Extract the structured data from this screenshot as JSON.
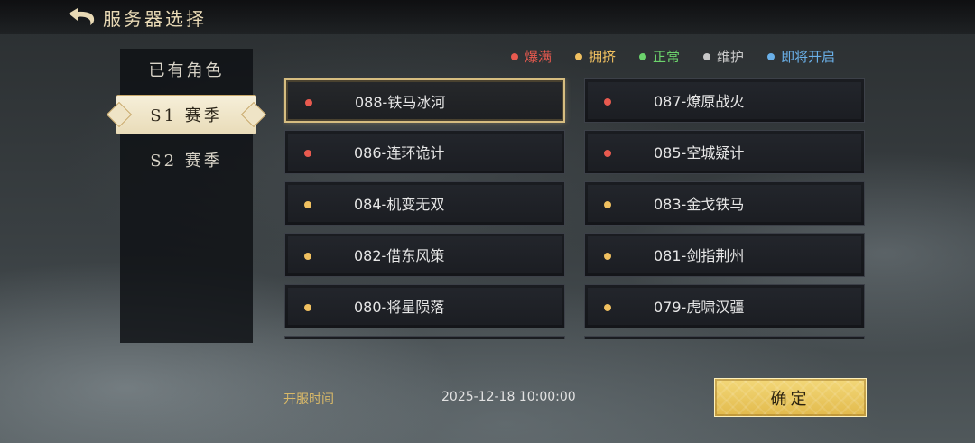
{
  "header": {
    "title": "服务器选择",
    "back_icon": "back-arrow-icon"
  },
  "sidebar": {
    "items": [
      {
        "label": "已有角色",
        "active": false
      },
      {
        "label": "S1 赛季",
        "active": true
      },
      {
        "label": "S2 赛季",
        "active": false
      }
    ]
  },
  "legend": [
    {
      "label": "爆满",
      "color": "#e85a4f"
    },
    {
      "label": "拥挤",
      "color": "#f0c060"
    },
    {
      "label": "正常",
      "color": "#6cd36c"
    },
    {
      "label": "维护",
      "color": "#c8c8c8"
    },
    {
      "label": "即将开启",
      "color": "#6ab0e8"
    }
  ],
  "servers": [
    {
      "name": "088-铁马冰河",
      "status": "爆满",
      "color": "#e85a4f",
      "selected": true
    },
    {
      "name": "087-燎原战火",
      "status": "爆满",
      "color": "#e85a4f",
      "selected": false
    },
    {
      "name": "086-连环诡计",
      "status": "爆满",
      "color": "#e85a4f",
      "selected": false
    },
    {
      "name": "085-空城疑计",
      "status": "爆满",
      "color": "#e85a4f",
      "selected": false
    },
    {
      "name": "084-机变无双",
      "status": "拥挤",
      "color": "#f0c060",
      "selected": false
    },
    {
      "name": "083-金戈铁马",
      "status": "拥挤",
      "color": "#f0c060",
      "selected": false
    },
    {
      "name": "082-借东风策",
      "status": "拥挤",
      "color": "#f0c060",
      "selected": false
    },
    {
      "name": "081-剑指荆州",
      "status": "拥挤",
      "color": "#f0c060",
      "selected": false
    },
    {
      "name": "080-将星陨落",
      "status": "拥挤",
      "color": "#f0c060",
      "selected": false
    },
    {
      "name": "079-虎啸汉疆",
      "status": "拥挤",
      "color": "#f0c060",
      "selected": false
    }
  ],
  "footer": {
    "open_label": "开服时间",
    "open_time": "2025-12-18 10:00:00",
    "confirm_label": "确定"
  }
}
